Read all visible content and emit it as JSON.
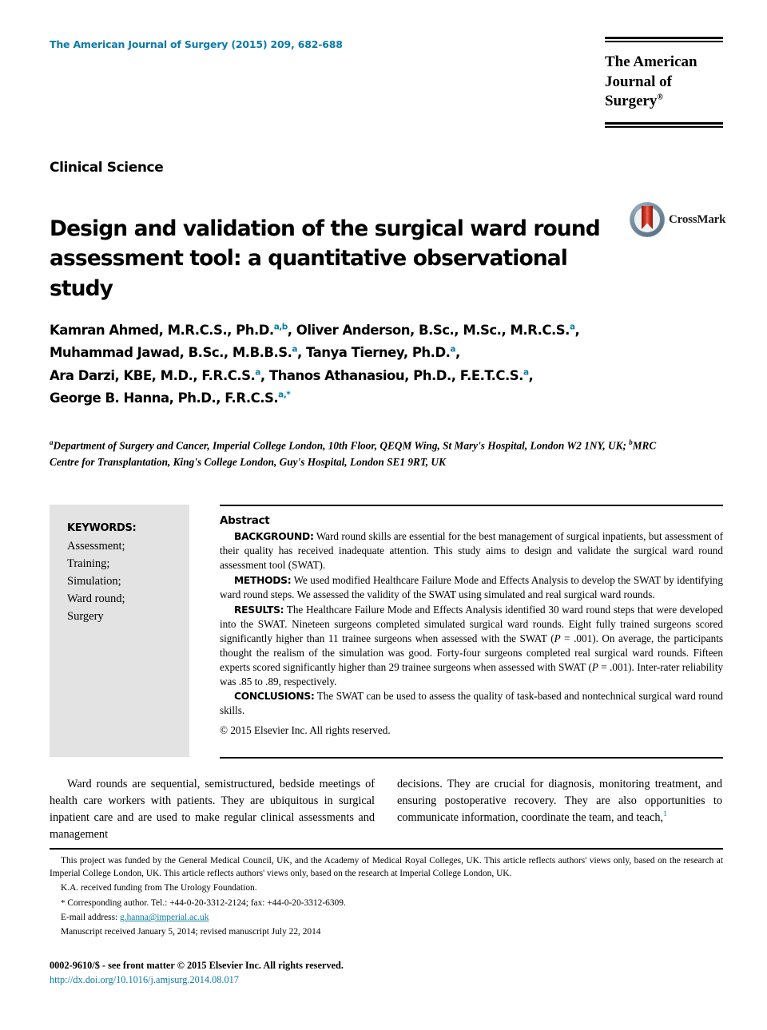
{
  "masthead": {
    "journal_reference": "The American Journal of Surgery (2015) 209, 682-688",
    "logo_line1": "The American",
    "logo_line2": "Journal of Surgery",
    "logo_trademark": "®"
  },
  "article": {
    "section_label": "Clinical Science",
    "title": "Design and validation of the surgical ward round assessment tool: a quantitative observational study",
    "crossmark_label": "CrossMark"
  },
  "authors": {
    "line1_name1": "Kamran Ahmed, M.R.C.S., Ph.D.",
    "line1_sup1": "a,b",
    "line1_name2": ", Oliver Anderson, B.Sc., M.Sc., M.R.C.S.",
    "line1_sup2": "a",
    "line1_tail": ",",
    "line2_name1": "Muhammad Jawad, B.Sc., M.B.B.S.",
    "line2_sup1": "a",
    "line2_name2": ", Tanya Tierney, Ph.D.",
    "line2_sup2": "a",
    "line2_tail": ",",
    "line3_name1": "Ara Darzi, KBE, M.D., F.R.C.S.",
    "line3_sup1": "a",
    "line3_name2": ", Thanos Athanasiou, Ph.D., F.E.T.C.S.",
    "line3_sup2": "a",
    "line3_tail": ",",
    "line4_name1": "George B. Hanna, Ph.D., F.R.C.S.",
    "line4_sup1": "a,*"
  },
  "affiliations": {
    "marker_a": "a",
    "text_a": "Department of Surgery and Cancer, Imperial College London, 10th Floor, QEQM Wing, St Mary's Hospital, London W2 1NY, UK; ",
    "marker_b": "b",
    "text_b": "MRC Centre for Transplantation, King's College London, Guy's Hospital, London SE1 9RT, UK"
  },
  "keywords": {
    "heading": "KEYWORDS:",
    "items": [
      "Assessment;",
      "Training;",
      "Simulation;",
      "Ward round;",
      "Surgery"
    ]
  },
  "abstract": {
    "heading": "Abstract",
    "background_label": "BACKGROUND:",
    "background_text": "Ward round skills are essential for the best management of surgical inpatients, but assessment of their quality has received inadequate attention. This study aims to design and validate the surgical ward round assessment tool (SWAT).",
    "methods_label": "METHODS:",
    "methods_text": "We used modified Healthcare Failure Mode and Effects Analysis to develop the SWAT by identifying ward round steps. We assessed the validity of the SWAT using simulated and real surgical ward rounds.",
    "results_label": "RESULTS:",
    "results_part1": "The Healthcare Failure Mode and Effects Analysis identified 30 ward round steps that were developed into the SWAT. Nineteen surgeons completed simulated surgical ward rounds. Eight fully trained surgeons scored significantly higher than 11 trainee surgeons when assessed with the SWAT (",
    "results_italic1": "P",
    "results_part2": " = .001). On average, the participants thought the realism of the simulation was good. Forty-four surgeons completed real surgical ward rounds. Fifteen experts scored significantly higher than 29 trainee surgeons when assessed with SWAT (",
    "results_italic2": "P",
    "results_part3": " = .001). Inter-rater reliability was .85 to .89, respectively.",
    "conclusions_label": "CONCLUSIONS:",
    "conclusions_text": "The SWAT can be used to assess the quality of task-based and nontechnical surgical ward round skills.",
    "copyright": "© 2015 Elsevier Inc. All rights reserved."
  },
  "body": {
    "left_column": "Ward rounds are sequential, semistructured, bedside meetings of health care workers with patients. They are ubiquitous in surgical inpatient care and are used to make regular clinical assessments and management",
    "right_column_text": "decisions. They are crucial for diagnosis, monitoring treatment, and ensuring postoperative recovery. They are also opportunities to communicate information, coordinate the team, and teach,",
    "right_column_ref": "1"
  },
  "footnotes": {
    "funding": "This project was funded by the General Medical Council, UK, and the Academy of Medical Royal Colleges, UK. This article reflects authors' views only, based on the research at Imperial College London, UK. This article reflects authors' views only, based on the research at Imperial College London, UK.",
    "urology": "K.A. received funding from The Urology Foundation.",
    "corresponding_marker": "*",
    "corresponding": " Corresponding author. Tel.: +44-0-20-3312-2124; fax: +44-0-20-3312-6309.",
    "email_label": "E-mail address: ",
    "email": "g.hanna@imperial.ac.uk",
    "manuscript": "Manuscript received January 5, 2014; revised manuscript July 22, 2014"
  },
  "bottom": {
    "issn_line": "0002-9610/$ - see front matter © 2015 Elsevier Inc. All rights reserved.",
    "doi": "http://dx.doi.org/10.1016/j.amjsurg.2014.08.017"
  },
  "colors": {
    "accent_blue": "#0b7ba8",
    "keyword_box_gray": "#e3e3e3",
    "crossmark_red": "#c4291c"
  }
}
